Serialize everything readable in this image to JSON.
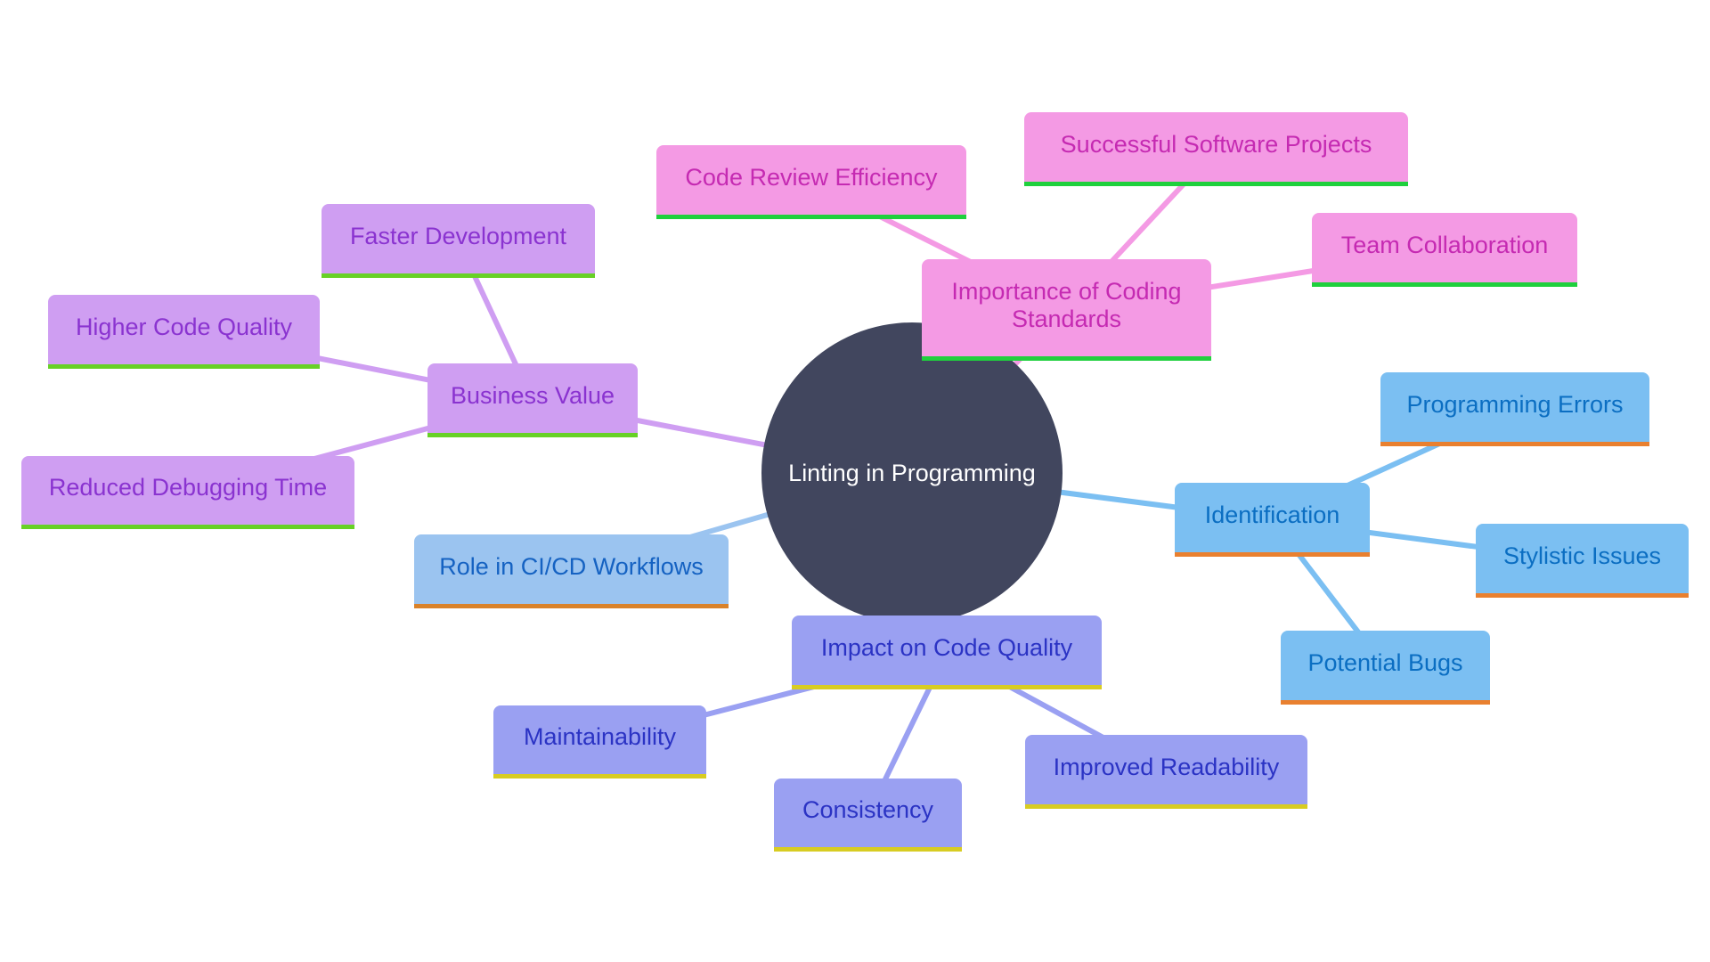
{
  "diagram": {
    "type": "mind-map",
    "root": {
      "id": "root",
      "label": "Linting in Programming",
      "color": "#41465e",
      "text_color": "#ffffff"
    },
    "branches": [
      {
        "id": "coding-standards",
        "label": "Importance of Coding Standards",
        "palette": "pink",
        "fill": "#f49ae4",
        "text": "#c52ab2",
        "underline": "#1fd03d",
        "edge": "#f49ae4",
        "children": [
          {
            "id": "code-review",
            "label": "Code Review Efficiency"
          },
          {
            "id": "successful-projects",
            "label": "Successful Software Projects"
          },
          {
            "id": "team-collab",
            "label": "Team Collaboration"
          }
        ]
      },
      {
        "id": "business-value",
        "label": "Business Value",
        "palette": "violet",
        "fill": "#cf9ef2",
        "text": "#8a33d0",
        "underline": "#67d126",
        "edge": "#cf9ef2",
        "children": [
          {
            "id": "faster-dev",
            "label": "Faster Development"
          },
          {
            "id": "higher-quality",
            "label": "Higher Code Quality"
          },
          {
            "id": "reduced-debug",
            "label": "Reduced Debugging Time"
          }
        ]
      },
      {
        "id": "cicd",
        "label": "Role in CI/CD Workflows",
        "palette": "light-blue",
        "fill": "#9bc4f0",
        "text": "#1562c2",
        "underline": "#d9822a",
        "edge": "#9bc4f0",
        "children": []
      },
      {
        "id": "identification",
        "label": "Identification",
        "palette": "sky",
        "fill": "#7bbff2",
        "text": "#0b6ec2",
        "underline": "#e9802f",
        "edge": "#7bbff2",
        "children": [
          {
            "id": "prog-errors",
            "label": "Programming Errors"
          },
          {
            "id": "stylistic",
            "label": "Stylistic Issues"
          },
          {
            "id": "potential-bugs",
            "label": "Potential Bugs"
          }
        ]
      },
      {
        "id": "impact-quality",
        "label": "Impact on Code Quality",
        "palette": "periwinkle",
        "fill": "#9aa0f2",
        "text": "#2b33c4",
        "underline": "#d8cc22",
        "edge": "#9aa0f2",
        "children": [
          {
            "id": "maintainability",
            "label": "Maintainability"
          },
          {
            "id": "consistency",
            "label": "Consistency"
          },
          {
            "id": "readability",
            "label": "Improved Readability"
          }
        ]
      }
    ]
  }
}
